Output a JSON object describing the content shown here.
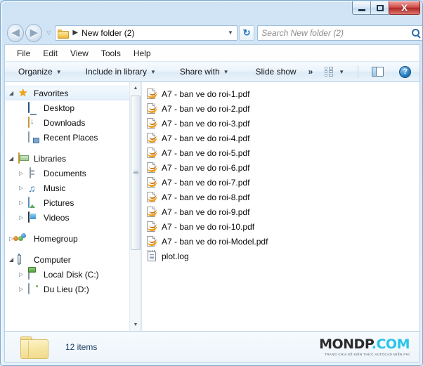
{
  "window": {
    "titlebar": {
      "minimize_label": "Minimize",
      "maximize_label": "Maximize",
      "close_label": "X"
    }
  },
  "address_bar": {
    "back_glyph": "◀",
    "forward_glyph": "▶",
    "history_glyph": "▽",
    "breadcrumb_separator": "▶",
    "path_label": "New folder (2)",
    "dropdown_glyph": "▼",
    "refresh_glyph": "↻"
  },
  "search": {
    "placeholder": "Search New folder (2)",
    "value": ""
  },
  "menu": {
    "items": [
      {
        "label": "File"
      },
      {
        "label": "Edit"
      },
      {
        "label": "View"
      },
      {
        "label": "Tools"
      },
      {
        "label": "Help"
      }
    ]
  },
  "toolbar": {
    "organize_label": "Organize",
    "include_label": "Include in library",
    "share_label": "Share with",
    "slideshow_label": "Slide show",
    "overflow_label": "»",
    "caret_glyph": "▼",
    "help_glyph": "?"
  },
  "navigation_pane": {
    "groups": [
      {
        "header": {
          "label": "Favorites",
          "twisty": "◢",
          "icon": "star-icon",
          "highlighted": true
        },
        "children": [
          {
            "label": "Desktop",
            "icon": "desktop-icon",
            "twisty": ""
          },
          {
            "label": "Downloads",
            "icon": "downloads-icon",
            "twisty": ""
          },
          {
            "label": "Recent Places",
            "icon": "recent-places-icon",
            "twisty": ""
          }
        ]
      },
      {
        "header": {
          "label": "Libraries",
          "twisty": "◢",
          "icon": "libraries-icon",
          "highlighted": false
        },
        "children": [
          {
            "label": "Documents",
            "icon": "documents-icon",
            "twisty": "▷"
          },
          {
            "label": "Music",
            "icon": "music-icon",
            "twisty": "▷"
          },
          {
            "label": "Pictures",
            "icon": "pictures-icon",
            "twisty": "▷"
          },
          {
            "label": "Videos",
            "icon": "videos-icon",
            "twisty": "▷"
          }
        ]
      },
      {
        "header": {
          "label": "Homegroup",
          "twisty": "▷",
          "icon": "homegroup-icon",
          "highlighted": false
        },
        "children": []
      },
      {
        "header": {
          "label": "Computer",
          "twisty": "◢",
          "icon": "computer-icon",
          "highlighted": false
        },
        "children": [
          {
            "label": "Local Disk (C:)",
            "icon": "local-disk-icon",
            "twisty": "▷"
          },
          {
            "label": "Du Lieu (D:)",
            "icon": "drive-icon",
            "twisty": "▷"
          }
        ]
      }
    ],
    "scrollbar": {
      "up_glyph": "▲",
      "down_glyph": "▼"
    }
  },
  "file_list": {
    "files": [
      {
        "name": "A7 - ban ve do roi-1.pdf",
        "icon": "pdf-file-icon"
      },
      {
        "name": "A7 - ban ve do roi-2.pdf",
        "icon": "pdf-file-icon"
      },
      {
        "name": "A7 - ban ve do roi-3.pdf",
        "icon": "pdf-file-icon"
      },
      {
        "name": "A7 - ban ve do roi-4.pdf",
        "icon": "pdf-file-icon"
      },
      {
        "name": "A7 - ban ve do roi-5.pdf",
        "icon": "pdf-file-icon"
      },
      {
        "name": "A7 - ban ve do roi-6.pdf",
        "icon": "pdf-file-icon"
      },
      {
        "name": "A7 - ban ve do roi-7.pdf",
        "icon": "pdf-file-icon"
      },
      {
        "name": "A7 - ban ve do roi-8.pdf",
        "icon": "pdf-file-icon"
      },
      {
        "name": "A7 - ban ve do roi-9.pdf",
        "icon": "pdf-file-icon"
      },
      {
        "name": "A7 - ban ve do roi-10.pdf",
        "icon": "pdf-file-icon"
      },
      {
        "name": "A7 - ban ve do roi-Model.pdf",
        "icon": "pdf-file-icon"
      },
      {
        "name": "plot.log",
        "icon": "log-file-icon"
      }
    ]
  },
  "status_bar": {
    "item_count_label": "12 items"
  },
  "watermark": {
    "logo_dark": "MONDP",
    "logo_cyan": ".COM",
    "tagline": "TRANG CHIA SẾ KIẾN THỨC AUTOCAD MIỄN PHÍ"
  },
  "colors": {
    "accent_blue": "#2b6ca8",
    "close_red": "#ad2a26",
    "pdf_orange": "#f0a01e",
    "watermark_cyan": "#29c4e8",
    "status_text": "#1b3d66"
  }
}
